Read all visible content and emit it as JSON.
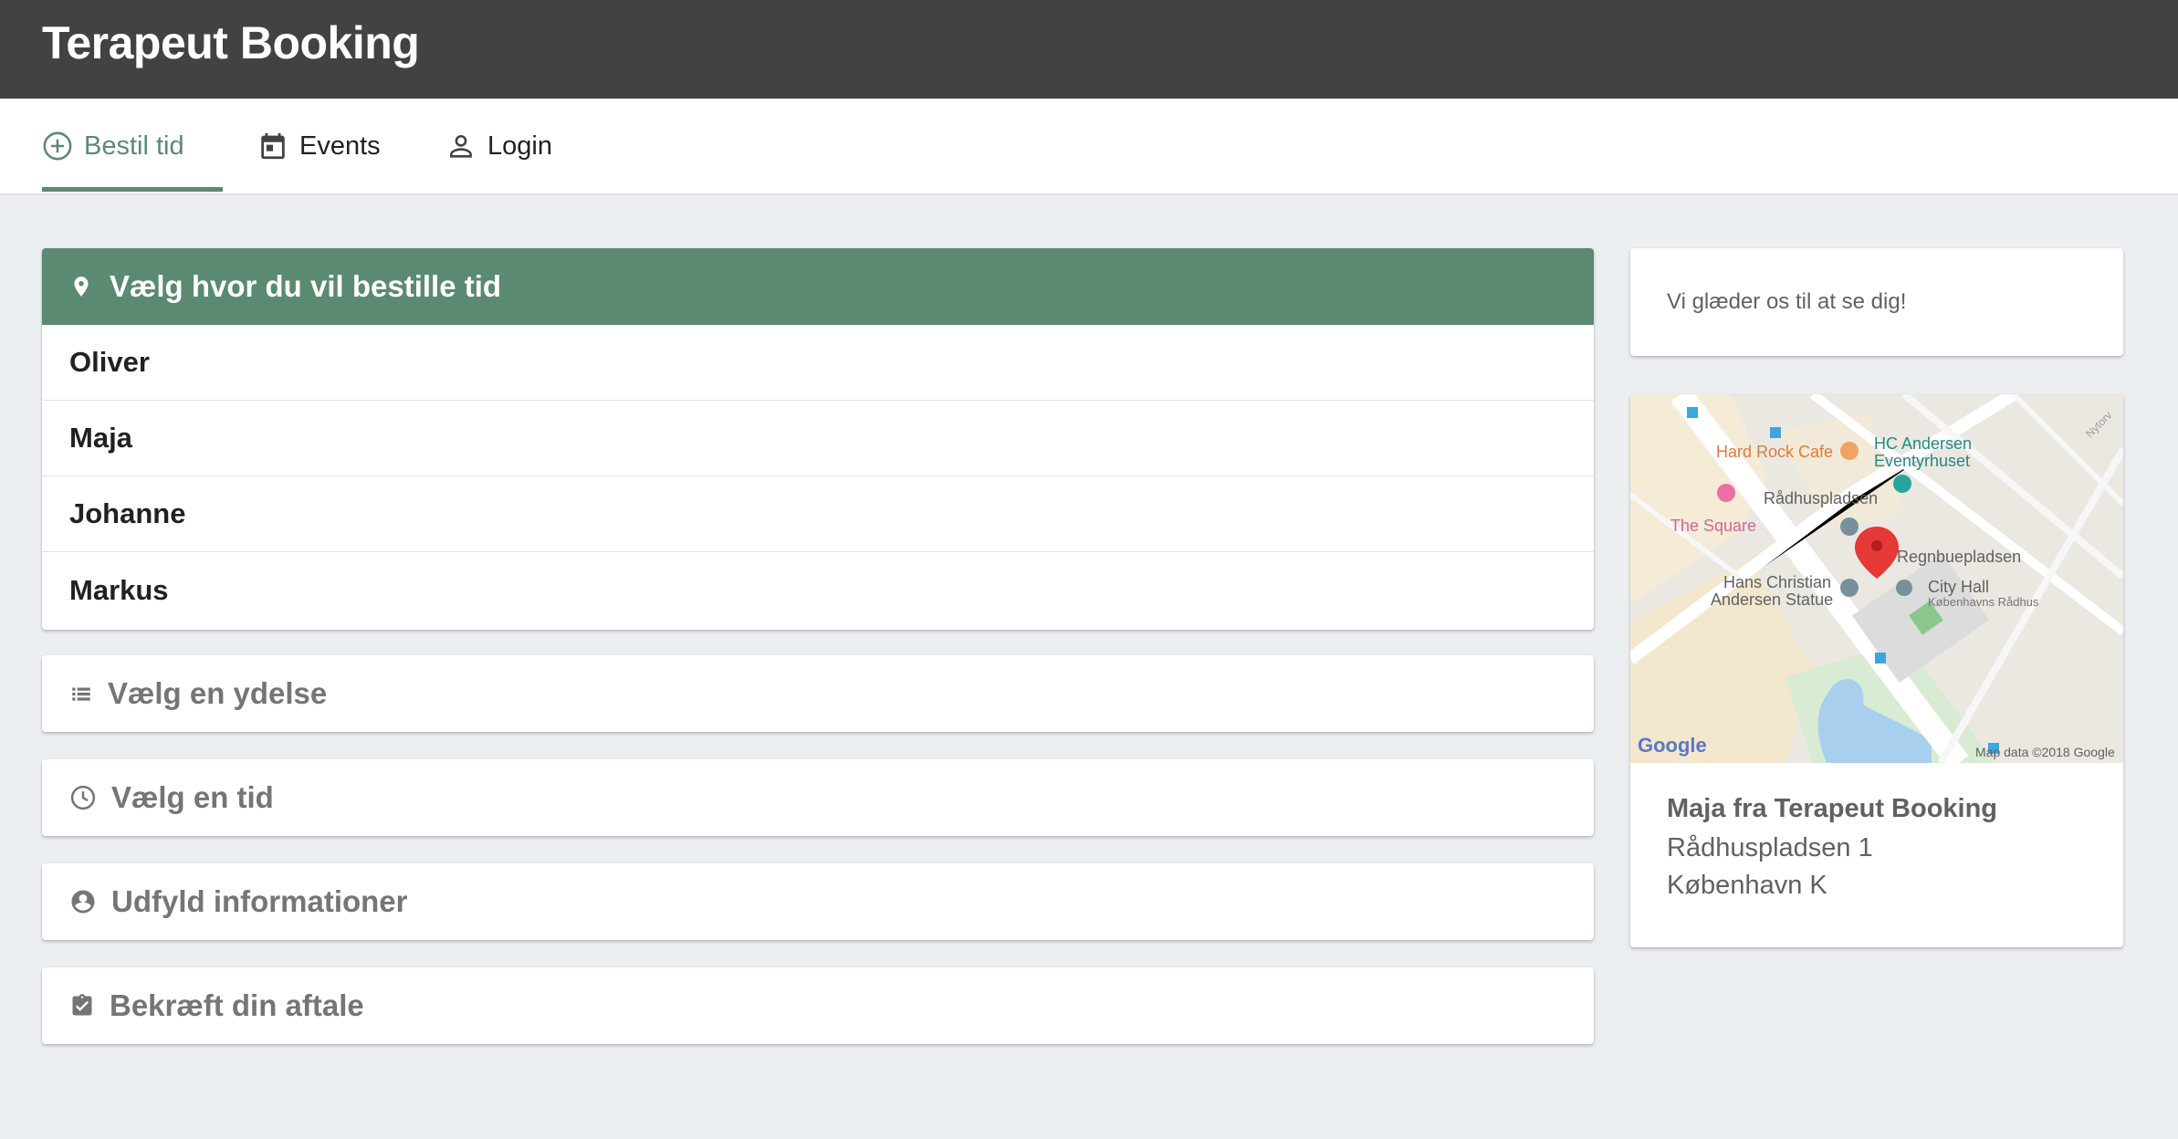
{
  "app": {
    "title": "Terapeut Booking"
  },
  "tabs": [
    {
      "label": "Bestil tid",
      "icon": "add-circle-icon",
      "active": true
    },
    {
      "label": "Events",
      "icon": "calendar-icon",
      "active": false
    },
    {
      "label": "Login",
      "icon": "person-icon",
      "active": false
    }
  ],
  "location_panel": {
    "title": "Vælg hvor du vil bestille tid",
    "icon": "location-pin-icon",
    "items": [
      "Oliver",
      "Maja",
      "Johanne",
      "Markus"
    ]
  },
  "steps": [
    {
      "label": "Vælg en ydelse",
      "icon": "list-icon"
    },
    {
      "label": "Vælg en tid",
      "icon": "clock-icon"
    },
    {
      "label": "Udfyld informationer",
      "icon": "account-circle-icon"
    },
    {
      "label": "Bekræft din aftale",
      "icon": "clipboard-check-icon"
    }
  ],
  "welcome": {
    "text": "Vi glæder os til at se dig!"
  },
  "map": {
    "labels": {
      "hard_rock": "Hard Rock Cafe",
      "hc_andersen": "HC Andersen",
      "eventyrhuset": "Eventyrhuset",
      "raadhuspladsen": "Rådhuspladsen",
      "the_square": "The Square",
      "regnbuepladsen": "Regnbuepladsen",
      "hans_christian": "Hans Christian",
      "andersen_statue": "Andersen Statue",
      "city_hall": "City Hall",
      "kobenhavns_raadhus": "Københavns Rådhus",
      "nyrorv": "Nytorv",
      "google": "Google",
      "map_data": "Map data ©2018 Google"
    },
    "colors": {
      "pin": "#e53935",
      "park": "#c8e6c9",
      "water": "#a8d0ee"
    }
  },
  "address": {
    "name": "Maja fra Terapeut Booking",
    "street": "Rådhuspladsen 1",
    "city": "København K"
  },
  "theme": {
    "accent": "#5a8a71",
    "topbar": "#424242",
    "background": "#eceff1"
  }
}
